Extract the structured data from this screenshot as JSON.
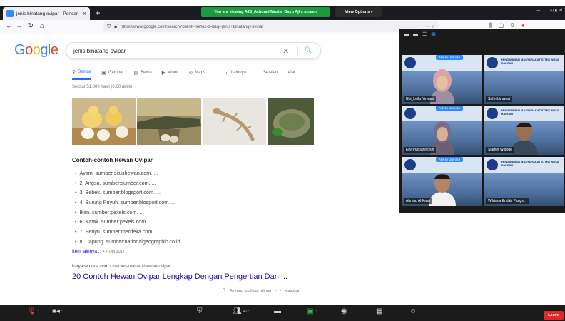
{
  "browser": {
    "tab_title": "jenis binatang ovipar - Pencar",
    "url": "https://www.google.com/search?client=firefox-b-d&q=jenis+binatang+ovipar",
    "url_suffix": "···  ☆"
  },
  "zoom": {
    "viewing_banner": "You are viewing A28_Achmad Mastar Bayu Aji's screen",
    "view_options": "View Options ▾",
    "participants_count": "40",
    "leave_label": "Leave",
    "participants": [
      {
        "name": "Nhi_Leila Nirwani",
        "unmute": "Ask to Unmute"
      },
      {
        "name": "Saftri Linawati",
        "unmute": ""
      },
      {
        "name": "Elly Puspaningsih",
        "unmute": "Ask to Unmute"
      },
      {
        "name": "Slamet Widodo",
        "unmute": ""
      },
      {
        "name": "Ahmad Al Kaafi",
        "unmute": "Ask to Unmute"
      },
      {
        "name": "Witriana Endah Pangs...",
        "unmute": ""
      }
    ],
    "banner_text": "PENGABDIAN MASYARAKAT STMIK NUSA MANDIRI"
  },
  "google": {
    "query": "jenis binatang ovipar",
    "tabs": [
      {
        "label": "Semua",
        "icon": "search-icon"
      },
      {
        "label": "Gambar",
        "icon": "image-icon"
      },
      {
        "label": "Berita",
        "icon": "news-icon"
      },
      {
        "label": "Video",
        "icon": "video-icon"
      },
      {
        "label": "Maps",
        "icon": "map-pin-icon"
      },
      {
        "label": "Lainnya",
        "icon": "more-icon"
      },
      {
        "label": "Setelan",
        "icon": ""
      },
      {
        "label": "Alat",
        "icon": ""
      }
    ],
    "result_stats": "Sekitar 51.800 hasil (0,60 detik)",
    "snippet_title": "Contoh-contoh Hewan Ovipar",
    "bullets": [
      "Ayam. sumber:situshewan.com. ...",
      "2. Angsa. sumber:sumber.com. ...",
      "3. Bebek. sumber:blogsport.com. ...",
      "4. Burung Puyuh. sumber:blosport.com. ...",
      "Ikan. sumber:pexels.com. ...",
      "6. Katak. sumber:pexels.com. ...",
      "7. Penyu. sumber:merdeka.com. ...",
      "8. Capung. sumber:nationalgeographic.co.id."
    ],
    "more_items": "Item lainnya...",
    "more_date": "• 7 Okt 2017",
    "source_domain": "karyapemuda.com",
    "source_path": " › macam-macam-hewan-ovipar",
    "result_title": "20 Contoh Hewan Ovipar Lengkap Dengan Pengertian Dan ...",
    "about_snippets": "Tentang cuplikan pilihan",
    "feedback": "Masukan"
  }
}
